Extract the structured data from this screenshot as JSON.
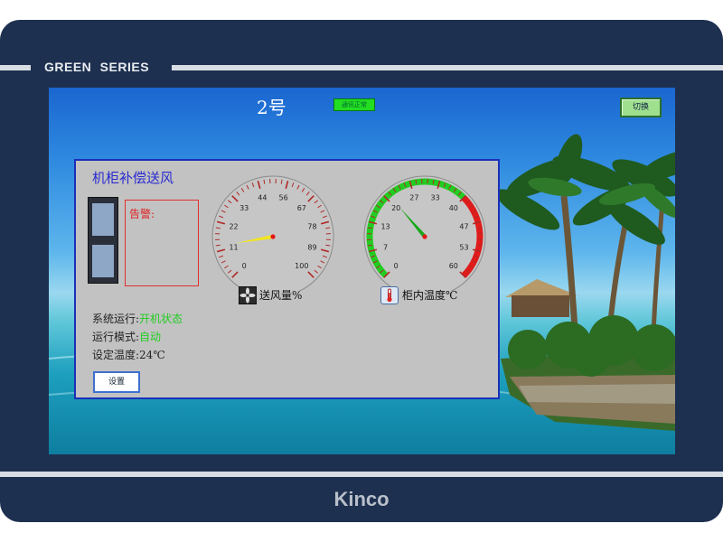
{
  "bezel": {
    "series": "GREEN SERIES",
    "brand": "Kinco"
  },
  "screen": {
    "title": "2号",
    "status_indicator": "通讯正常",
    "top_button": "切换"
  },
  "panel": {
    "title": "机柜补偿送风",
    "alarm_label": "告警:",
    "airflow_gauge": {
      "caption": "送风量%",
      "min": 0,
      "max": 100,
      "value": 13,
      "ticks": [
        "0",
        "11",
        "22",
        "33",
        "44",
        "56",
        "67",
        "78",
        "89",
        "100"
      ]
    },
    "temp_gauge": {
      "caption": "柜内温度℃",
      "min": 0,
      "max": 60,
      "value": 21,
      "ticks": [
        "0",
        "7",
        "13",
        "20",
        "27",
        "33",
        "40",
        "47",
        "53",
        "60"
      ],
      "green_until": 40
    },
    "rows": [
      {
        "label": "系统运行:",
        "value": "开机状态"
      },
      {
        "label": "运行模式:",
        "value": "自动"
      },
      {
        "label": "设定温度:",
        "value": "24℃"
      }
    ],
    "settings_button": "设置"
  },
  "colors": {
    "panel_border": "#1b2fb8",
    "value_green": "#22cc22",
    "gauge_red": "#b02828"
  }
}
